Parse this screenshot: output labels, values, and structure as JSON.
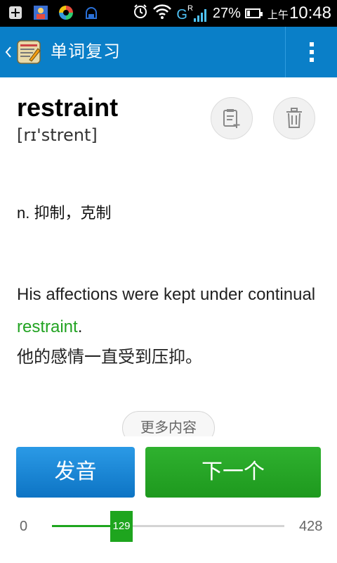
{
  "status_bar": {
    "network_label": "G",
    "roaming_label": "R",
    "battery_percent": "27%",
    "battery_level": 0.27,
    "ampm": "上午",
    "time": "10:48"
  },
  "action_bar": {
    "title": "单词复习"
  },
  "word": {
    "text": "restraint",
    "phonetic": "[rɪ'strent]",
    "definition": "n. 抑制，克制",
    "example_before": "His affections were kept under continual ",
    "example_highlight": "restraint",
    "example_after": ".",
    "translation": "他的感情一直受到压抑。"
  },
  "more_button": "更多内容",
  "buttons": {
    "pronounce": "发音",
    "next": "下一个"
  },
  "progress": {
    "min": "0",
    "max": "428",
    "current": "129",
    "value": 129,
    "total": 428
  },
  "colors": {
    "action_bar": "#0a7fc8",
    "highlight": "#22a322",
    "pronounce_button": "#1f8fe0",
    "next_button": "#22a322"
  }
}
